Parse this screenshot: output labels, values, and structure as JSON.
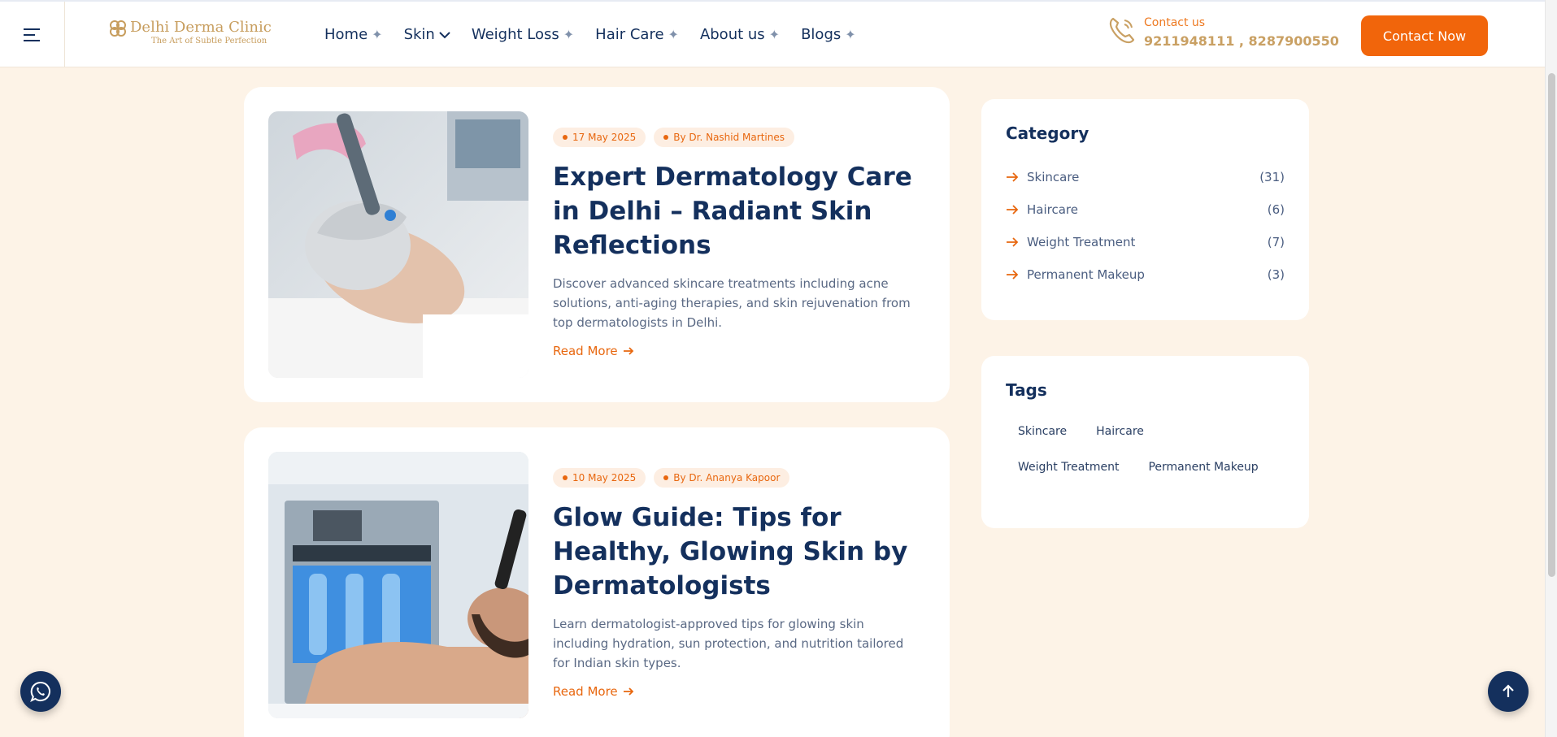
{
  "header": {
    "logo_title": "Delhi Derma Clinic",
    "logo_subtitle": "The Art of Subtle Perfection",
    "nav": [
      {
        "label": "Home",
        "icon": "plus-icon"
      },
      {
        "label": "Skin",
        "icon": "chevron-down-icon"
      },
      {
        "label": "Weight Loss",
        "icon": "plus-icon"
      },
      {
        "label": "Hair Care",
        "icon": "plus-icon"
      },
      {
        "label": "About us",
        "icon": "plus-icon"
      },
      {
        "label": "Blogs",
        "icon": "plus-icon"
      }
    ],
    "contact_label": "Contact us",
    "contact_phones": "9211948111 , 8287900550",
    "cta_label": "Contact Now"
  },
  "posts": [
    {
      "date": "17 May 2025",
      "author": "By Dr. Nashid Martines",
      "title": "Expert Dermatology Care in Delhi – Radiant Skin Reflections",
      "excerpt": "Discover advanced skincare treatments including acne solutions, anti-aging therapies, and skin rejuvenation from top dermatologists in Delhi.",
      "read_more": "Read More",
      "image": "woman-facial-treatment-photo"
    },
    {
      "date": "10 May 2025",
      "author": "By Dr. Ananya Kapoor",
      "title": "Glow Guide: Tips for Healthy, Glowing Skin by Dermatologists",
      "excerpt": "Learn dermatologist-approved tips for glowing skin including hydration, sun protection, and nutrition tailored for Indian skin types.",
      "read_more": "Read More",
      "image": "man-hydrafacial-treatment-photo"
    }
  ],
  "sidebar": {
    "category_title": "Category",
    "categories": [
      {
        "label": "Skincare",
        "count": "(31)"
      },
      {
        "label": "Haircare",
        "count": "(6)"
      },
      {
        "label": "Weight Treatment",
        "count": "(7)"
      },
      {
        "label": "Permanent Makeup",
        "count": "(3)"
      }
    ],
    "tags_title": "Tags",
    "tags": [
      "Skincare",
      "Haircare",
      "Weight Treatment",
      "Permanent Makeup"
    ]
  },
  "colors": {
    "accent": "#f1650b",
    "navy": "#14305d",
    "gold": "#c9a063",
    "background": "#fdf3e7"
  }
}
